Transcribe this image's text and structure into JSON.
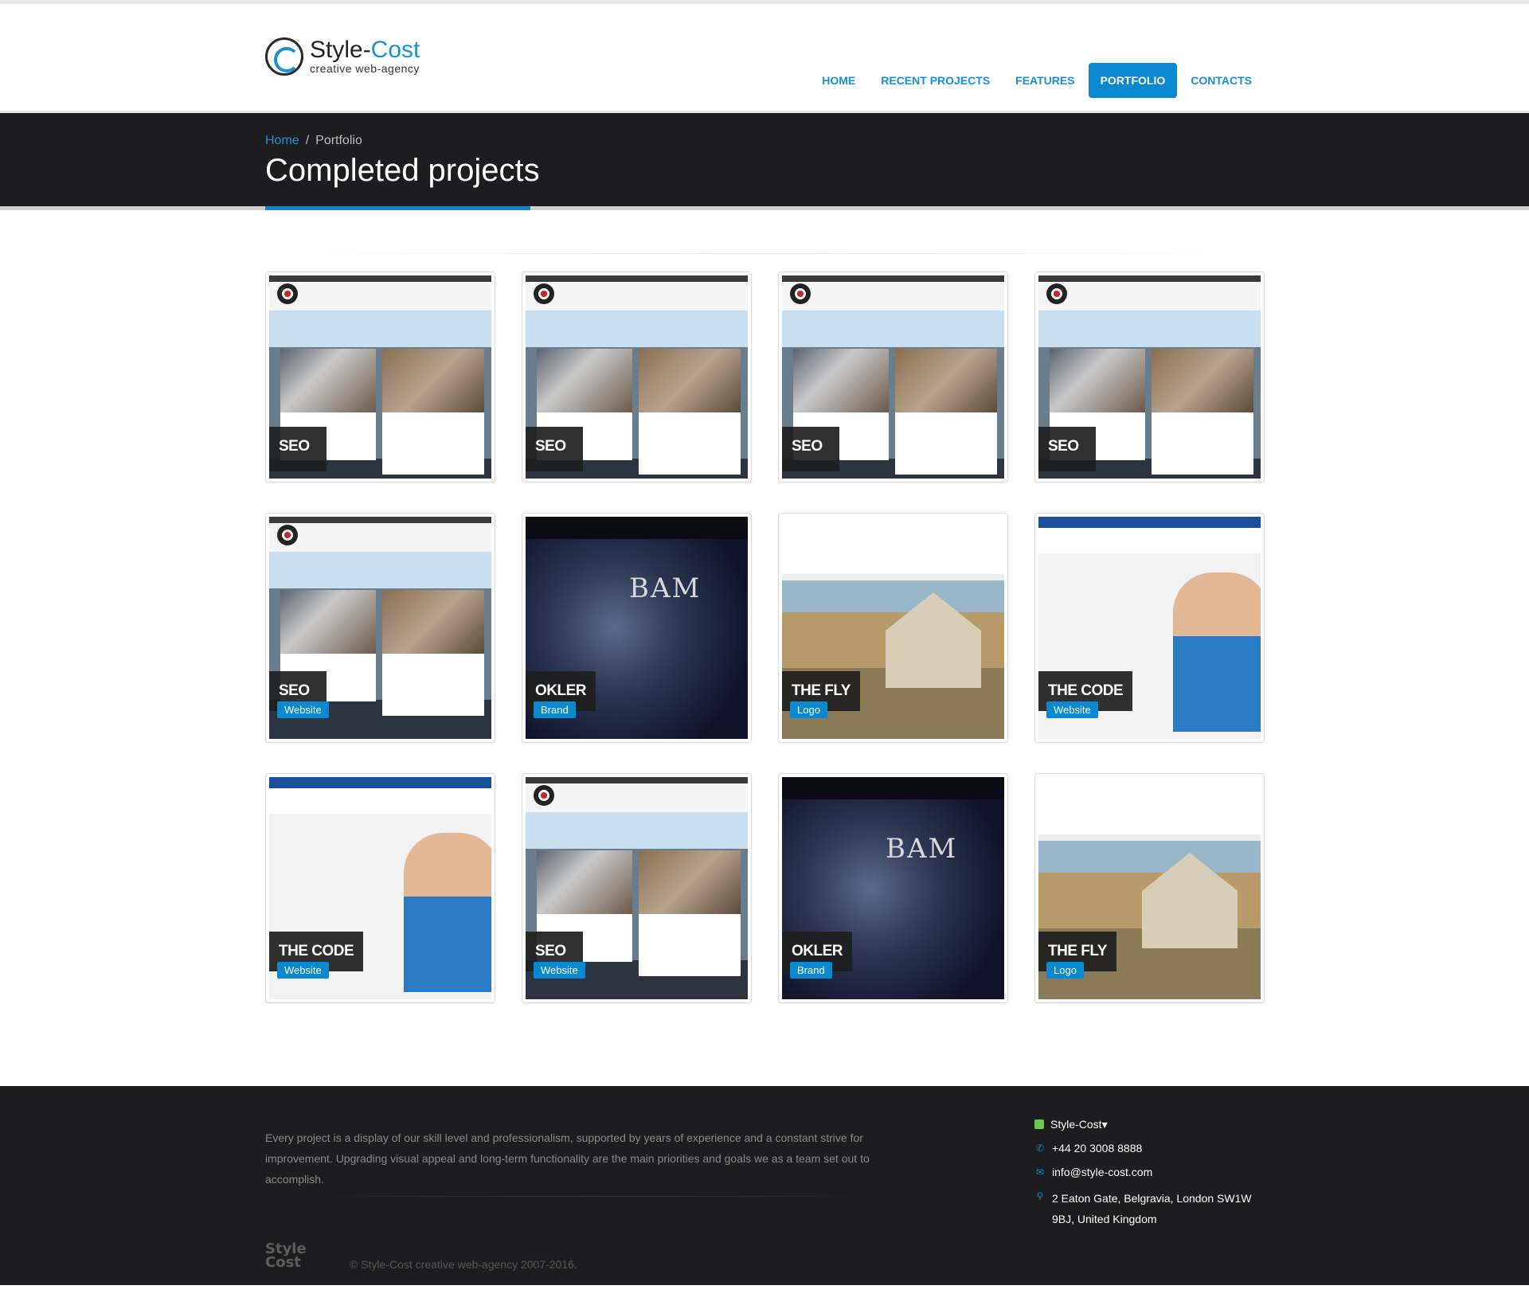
{
  "brand": {
    "name_part1": "Style-",
    "name_part2": "Cost",
    "tagline": "creative web-agency"
  },
  "nav": {
    "items": [
      {
        "label": "HOME",
        "active": false
      },
      {
        "label": "RECENT PROJECTS",
        "active": false
      },
      {
        "label": "FEATURES",
        "active": false
      },
      {
        "label": "PORTFOLIO",
        "active": true
      },
      {
        "label": "CONTACTS",
        "active": false
      }
    ]
  },
  "breadcrumb": {
    "home": "Home",
    "separator": "/",
    "current": "Portfolio"
  },
  "page": {
    "title": "Completed projects"
  },
  "portfolio": {
    "items": [
      {
        "name": "SEO",
        "tag": ""
      },
      {
        "name": "SEO",
        "tag": ""
      },
      {
        "name": "SEO",
        "tag": ""
      },
      {
        "name": "SEO",
        "tag": ""
      },
      {
        "name": "SEO",
        "tag": "Website"
      },
      {
        "name": "OKLER",
        "tag": "Brand"
      },
      {
        "name": "THE FLY",
        "tag": "Logo"
      },
      {
        "name": "THE CODE",
        "tag": "Website"
      },
      {
        "name": "THE CODE",
        "tag": "Website"
      },
      {
        "name": "SEO",
        "tag": "Website"
      },
      {
        "name": "OKLER",
        "tag": "Brand"
      },
      {
        "name": "THE FLY",
        "tag": "Logo"
      }
    ]
  },
  "footer": {
    "about": "Every project is a display of our skill level and professionalism, supported by years of experience and a constant strive for improvement. Upgrading visual appeal and long-term functionality are the main priorities and goals we as a team set out to accomplish.",
    "contact_brand": "Style-Cost▾",
    "phone": "+44 20 3008 8888",
    "email": "info@style-cost.com",
    "address": "2 Eaton Gate, Belgravia, London SW1W 9BJ, United Kingdom",
    "logo_line1": "Style",
    "logo_line2": "Cost",
    "copyright": "© Style-Cost creative web-agency 2007-2016."
  },
  "colors": {
    "accent": "#0a88d0",
    "dark": "#1d1d1f"
  },
  "icons": {
    "phone": "phone-icon",
    "email": "envelope-icon",
    "address": "map-marker-icon"
  }
}
